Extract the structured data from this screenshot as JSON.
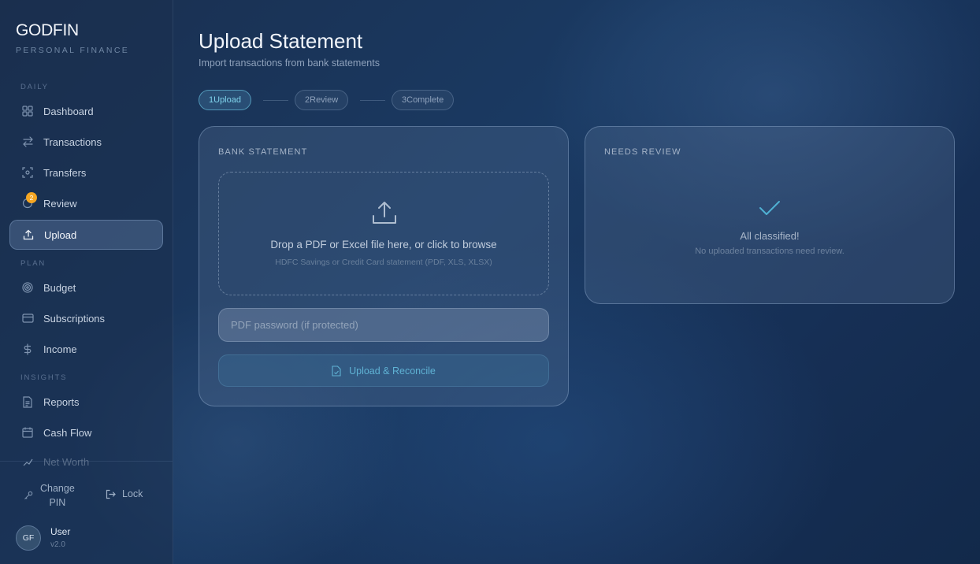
{
  "brand": {
    "name": "GODFIN",
    "subtitle": "PERSONAL FINANCE"
  },
  "sidebar": {
    "sections": {
      "daily": "DAILY",
      "plan": "PLAN",
      "insights": "INSIGHTS"
    },
    "items": {
      "dashboard": {
        "label": "Dashboard",
        "icon": "grid-icon"
      },
      "transactions": {
        "label": "Transactions",
        "icon": "arrows-swap-icon"
      },
      "transfers": {
        "label": "Transfers",
        "icon": "scan-icon"
      },
      "review": {
        "label": "Review",
        "icon": "circle-icon",
        "badge": "2"
      },
      "upload": {
        "label": "Upload",
        "icon": "upload-icon",
        "active": true
      },
      "budget": {
        "label": "Budget",
        "icon": "target-icon"
      },
      "subscriptions": {
        "label": "Subscriptions",
        "icon": "card-icon"
      },
      "income": {
        "label": "Income",
        "icon": "dollar-icon"
      },
      "reports": {
        "label": "Reports",
        "icon": "document-icon"
      },
      "cashflow": {
        "label": "Cash Flow",
        "icon": "calendar-icon"
      },
      "networth": {
        "label": "Net Worth",
        "icon": "chart-icon"
      }
    },
    "footer": {
      "change_pin_line1": "Change",
      "change_pin_line2": "PIN",
      "lock": "Lock",
      "avatar_initials": "GF",
      "user_name": "User",
      "version": "v2.0"
    }
  },
  "page": {
    "title": "Upload Statement",
    "subtitle": "Import transactions from bank statements"
  },
  "steps": [
    {
      "num": "1",
      "label": "Upload",
      "active": true
    },
    {
      "num": "2",
      "label": "Review",
      "active": false
    },
    {
      "num": "3",
      "label": "Complete",
      "active": false
    }
  ],
  "bank_card": {
    "title": "BANK STATEMENT",
    "drop_text": "Drop a PDF or Excel file here, or click to browse",
    "drop_hint": "HDFC Savings or Credit Card statement (PDF, XLS, XLSX)",
    "password_placeholder": "PDF password (if protected)",
    "password_value": "",
    "upload_button": "Upload & Reconcile"
  },
  "review_card": {
    "title": "NEEDS REVIEW",
    "empty_title": "All classified!",
    "empty_sub": "No uploaded transactions need review."
  },
  "colors": {
    "accent": "#7fd3ec",
    "badge": "#f5a623",
    "check": "#4fb0d2",
    "background": "#1a3a63"
  }
}
